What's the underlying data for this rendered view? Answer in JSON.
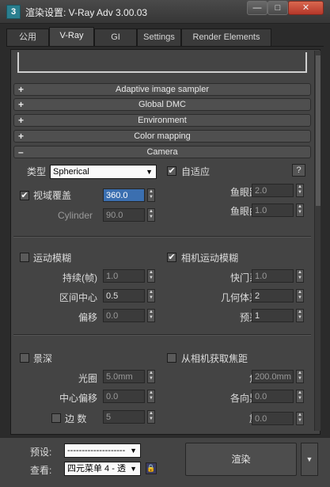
{
  "window": {
    "title": "渲染设置: V-Ray Adv 3.00.03",
    "icon": "3",
    "minimize": "—",
    "maximize": "□",
    "close": "✕"
  },
  "tabs": [
    "公用",
    "V-Ray",
    "GI",
    "Settings",
    "Render Elements"
  ],
  "active_tab": "V-Ray",
  "rollouts": [
    {
      "label": "Adaptive image sampler",
      "sign": "+"
    },
    {
      "label": "Global DMC",
      "sign": "+"
    },
    {
      "label": "Environment",
      "sign": "+"
    },
    {
      "label": "Color mapping",
      "sign": "+"
    },
    {
      "label": "Camera",
      "sign": "–"
    }
  ],
  "camera": {
    "type_label": "类型",
    "type_value": "Spherical",
    "auto_fit_label": "自适应",
    "auto_fit_checked": true,
    "help": "?",
    "override_fov_label": "视域覆盖",
    "override_fov_checked": true,
    "fov_value": "360.0",
    "cylinder_label": "Cylinder",
    "cylinder_value": "90.0",
    "fisheye_dist_label": "鱼眼距离",
    "fisheye_dist_value": "2.0",
    "fisheye_curve_label": "鱼眼曲度",
    "fisheye_curve_value": "1.0",
    "motion_blur_label": "运动模糊",
    "motion_blur_checked": false,
    "duration_label": "持续(帧)",
    "duration_value": "1.0",
    "interval_center_label": "区间中心",
    "interval_center_value": "0.5",
    "bias_label": "偏移",
    "bias_value": "0.0",
    "camera_motion_blur_label": "相机运动模糊",
    "camera_motion_blur_checked": true,
    "shutter_label": "快门系数",
    "shutter_value": "1.0",
    "geom_samples_label": "几何体采样",
    "geom_samples_value": "2",
    "prepass_label": "预采样",
    "prepass_value": "1",
    "dof_label": "景深",
    "dof_checked": false,
    "aperture_label": "光圈",
    "aperture_value": "5.0mm",
    "center_bias_label": "中心偏移",
    "center_bias_value": "0.0",
    "sides_label": "边  数",
    "sides_checked": false,
    "sides_value": "5",
    "get_focal_label": "从相机获取焦距",
    "get_focal_checked": false,
    "focal_dist_label": "焦距",
    "focal_dist_value": "200.0mm",
    "anisotropy_label": "各向异性",
    "anisotropy_value": "0.0",
    "rotation_label": "旋转",
    "rotation_value": "0.0"
  },
  "bottom": {
    "preset_label": "预设:",
    "preset_value": "--------------------",
    "view_label": "查看:",
    "view_value": "四元菜单 4 - 透",
    "render_label": "渲染",
    "render_dropdown": "▼",
    "lock_icon": "🔒"
  },
  "colors": {
    "panel_bg": "#444444",
    "title_bg": "#3c3c3c",
    "highlight": "#3b6fb0",
    "close_red": "#c9483a"
  }
}
